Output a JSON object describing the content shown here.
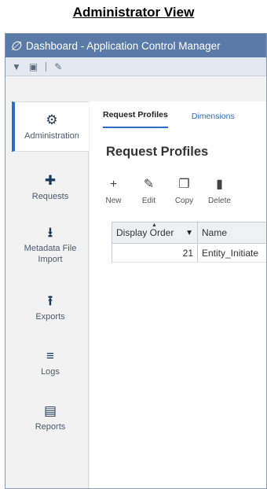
{
  "caption": "Administrator View",
  "window": {
    "title": "Dashboard - Application Control Manager",
    "logo_icon": "slash-logo-icon"
  },
  "toolbar": {
    "icons": [
      "filter-icon",
      "grid-icon",
      "pencil-icon"
    ]
  },
  "sidebar": {
    "items": [
      {
        "label": "Administration",
        "icon": "admin-gear-icon",
        "active": true
      },
      {
        "label": "Requests",
        "icon": "requests-add-icon",
        "active": false
      },
      {
        "label": "Metadata File Import",
        "icon": "download-icon",
        "active": false
      },
      {
        "label": "Exports",
        "icon": "upload-icon",
        "active": false
      },
      {
        "label": "Logs",
        "icon": "logs-search-icon",
        "active": false
      },
      {
        "label": "Reports",
        "icon": "clipboard-icon",
        "active": false
      }
    ]
  },
  "tabs": [
    {
      "label": "Request Profiles",
      "active": true
    },
    {
      "label": "Dimensions",
      "active": false
    }
  ],
  "main": {
    "title": "Request Profiles"
  },
  "actions": [
    {
      "label": "New",
      "icon": "plus-icon"
    },
    {
      "label": "Edit",
      "icon": "pencil-icon"
    },
    {
      "label": "Copy",
      "icon": "copy-icon"
    },
    {
      "label": "Delete",
      "icon": "trash-icon"
    }
  ],
  "grid": {
    "columns": [
      "Display Order",
      "Name"
    ],
    "rows": [
      {
        "order": "21",
        "name": "Entity_Initiate"
      }
    ]
  },
  "colors": {
    "titlebar": "#5a7ba8",
    "accent": "#2b6cc4"
  }
}
